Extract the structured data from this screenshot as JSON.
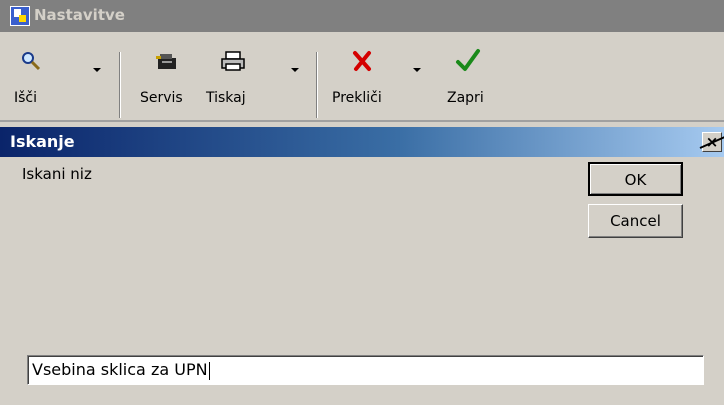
{
  "app": {
    "title": "Nastavitve"
  },
  "toolbar": {
    "search_label": "Išči",
    "service_label": "Servis",
    "print_label": "Tiskaj",
    "cancel_label": "Prekliči",
    "close_label": "Zapri"
  },
  "dialog": {
    "title": "Iskanje",
    "close_symbol": "×",
    "prompt": "Iskani niz",
    "ok_label": "OK",
    "cancel_label": "Cancel",
    "input_value": "Vsebina sklica za UPN"
  },
  "colors": {
    "titlebar_active": "#0a246a",
    "titlebar_inactive": "#808080",
    "face": "#d4d0c8",
    "cancel_icon": "#d40000",
    "ok_icon": "#1a8a1a"
  },
  "icons": [
    "app-icon",
    "search-icon",
    "service-icon",
    "print-icon",
    "cancel-x-icon",
    "checkmark-icon",
    "close-icon"
  ]
}
